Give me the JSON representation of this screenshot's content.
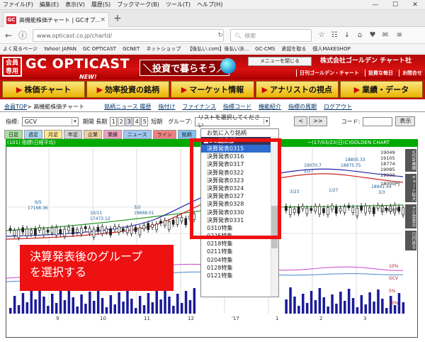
{
  "browser": {
    "menu": [
      "ファイル(F)",
      "編集(E)",
      "表示(V)",
      "履歴(S)",
      "ブックマーク(B)",
      "ツール(T)",
      "ヘルプ(H)"
    ],
    "window_controls": [
      "—",
      "☐",
      "✕"
    ],
    "tab_title": "高機能株価チャート | GCオプ...",
    "tab_close": "×",
    "new_tab": "+",
    "url": "www.opticast.co.jp/chartd/",
    "search_placeholder": "検索",
    "bookmarks": [
      "よく見るページ",
      "Yahoo! JAPAN",
      "GC OPTICAST",
      "GCNET",
      "ネットショップ",
      "【後払い.com】後払い決...",
      "GC-CMS",
      "承認を取る",
      "個人MAKESHOP"
    ]
  },
  "site": {
    "member_badge": "会員専用",
    "logo": "GC OPTICAST",
    "new_badge": "NEW!",
    "tagline": "＼投資で暮らそう／",
    "menu_button": "メニューを閉じる",
    "company": "株式会社ゴールデン チャート社",
    "header_links": [
      "日刊ゴールデン・チャート",
      "投資な毎日",
      "お問合せ"
    ],
    "main_nav": [
      "株価チャート",
      "効率投資の銘柄",
      "マーケット情報",
      "アナリストの視点",
      "業績・データ"
    ]
  },
  "crumb": {
    "home": "会員TOP",
    "current": "> 高機能株価チャート",
    "links": [
      "銘柄ニュース 履歴",
      "指付け",
      "ファイナンス",
      "指標コード",
      "機能紹介",
      "指標の周期",
      "ログアウト"
    ]
  },
  "controls": {
    "indicator_label": "指標:",
    "indicator_value": "GCV",
    "period_label": "期間 長期",
    "period_buttons": [
      "1",
      "2",
      "3",
      "4",
      "5"
    ],
    "short_label": "短期",
    "group_label": "グループ:",
    "group_value": "リストを選択してください",
    "nav_prev": "<",
    "nav_prev2": "<<",
    "nav_next": ">",
    "nav_next2": ">>",
    "code_label": "コード:",
    "show_button": "表示"
  },
  "color_tabs": [
    {
      "label": "日足",
      "color": "#a8e0a0"
    },
    {
      "label": "週足",
      "color": "#a8d8f0"
    },
    {
      "label": "月足",
      "color": "#ffe890"
    },
    {
      "label": "年足",
      "color": "#d0d0d0"
    },
    {
      "label": "企業",
      "color": "#f0d0a0"
    },
    {
      "label": "業績",
      "color": "#f0a0c0"
    },
    {
      "label": "ニュース",
      "color": "#a0c8f0"
    },
    {
      "label": "ライン",
      "color": "#f08080"
    },
    {
      "label": "銘柄",
      "color": "#80c0f0"
    }
  ],
  "chart": {
    "header_left": "(101) 指標(日経平均)",
    "header_right": "~(17/03/23)日(C)GOLDEN CHART",
    "price_labels": [
      "19049",
      "19105",
      "18774",
      "19085",
      "19000",
      "18000円",
      "17000円"
    ],
    "annotations": [
      "9/5",
      "17168.36",
      "10/11",
      "17473.12",
      "3/2",
      "19668.01",
      "18805.33",
      "18975.75",
      "3/23",
      "18941.44",
      "3/3",
      "19070.7",
      "2/27",
      "1/27"
    ],
    "pct_labels": [
      "10%",
      "GCV",
      "5%",
      "10%"
    ],
    "xaxis": [
      "9",
      "10",
      "11",
      "12",
      "'17",
      "1",
      "2",
      "3"
    ],
    "side_buttons": [
      "VIEW画面",
      "チャート拡大",
      "ナビ非表示",
      "日付戻る"
    ]
  },
  "dropdown": {
    "top_item": "お気に入り銘柄",
    "group_header": "■GC編集部",
    "items": [
      "決算発表0315",
      "決算発表0316",
      "決算発表0317",
      "決算発表0322",
      "決算発表0323",
      "決算発表0324",
      "決算発表0327",
      "決算発表0328",
      "決算発表0330",
      "決算発表0331",
      "0310特集",
      "0225特集",
      "0218特集",
      "0211特集",
      "0204特集",
      "0128特集",
      "0121特集"
    ],
    "highlighted_index": 0
  },
  "callout": {
    "line1": "決算発表後のグループ",
    "line2": "を選択する"
  }
}
